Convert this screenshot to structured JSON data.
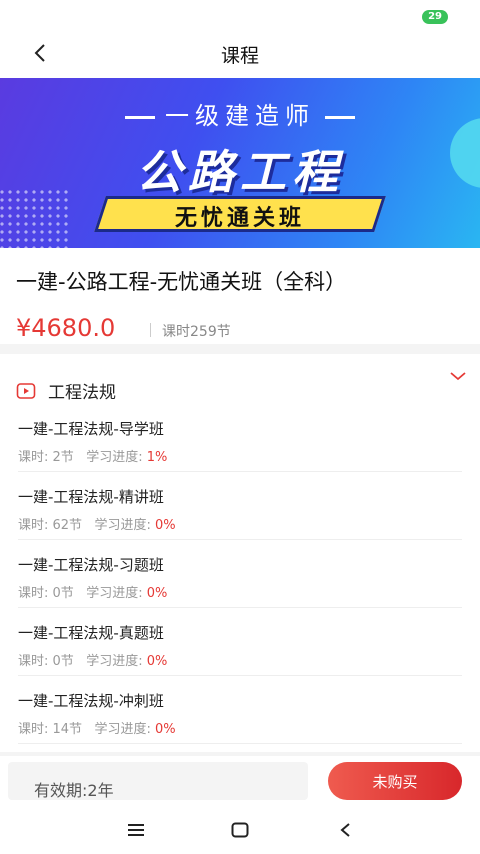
{
  "status": {
    "battery": "29"
  },
  "header": {
    "title": "课程"
  },
  "banner": {
    "subtitle": "一级建造师",
    "main": "公路工程",
    "ribbon": "无忧通关班"
  },
  "course": {
    "name": "一建-公路工程-无忧通关班（全科）",
    "price": "¥4680.0",
    "hours": "课时259节"
  },
  "chapter": {
    "title": "工程法规",
    "lessons": [
      {
        "title": "一建-工程法规-导学班",
        "hours": "课时: 2节",
        "progress_label": "学习进度: ",
        "progress": "1%"
      },
      {
        "title": "一建-工程法规-精讲班",
        "hours": "课时: 62节",
        "progress_label": "学习进度: ",
        "progress": "0%"
      },
      {
        "title": "一建-工程法规-习题班",
        "hours": "课时: 0节",
        "progress_label": "学习进度: ",
        "progress": "0%"
      },
      {
        "title": "一建-工程法规-真题班",
        "hours": "课时: 0节",
        "progress_label": "学习进度: ",
        "progress": "0%"
      },
      {
        "title": "一建-工程法规-冲刺班",
        "hours": "课时: 14节",
        "progress_label": "学习进度: ",
        "progress": "0%"
      }
    ]
  },
  "footer": {
    "validity": "有效期:2年",
    "buy_label": "未购买"
  },
  "colors": {
    "accent": "#e53935",
    "battery": "#39c25a"
  }
}
